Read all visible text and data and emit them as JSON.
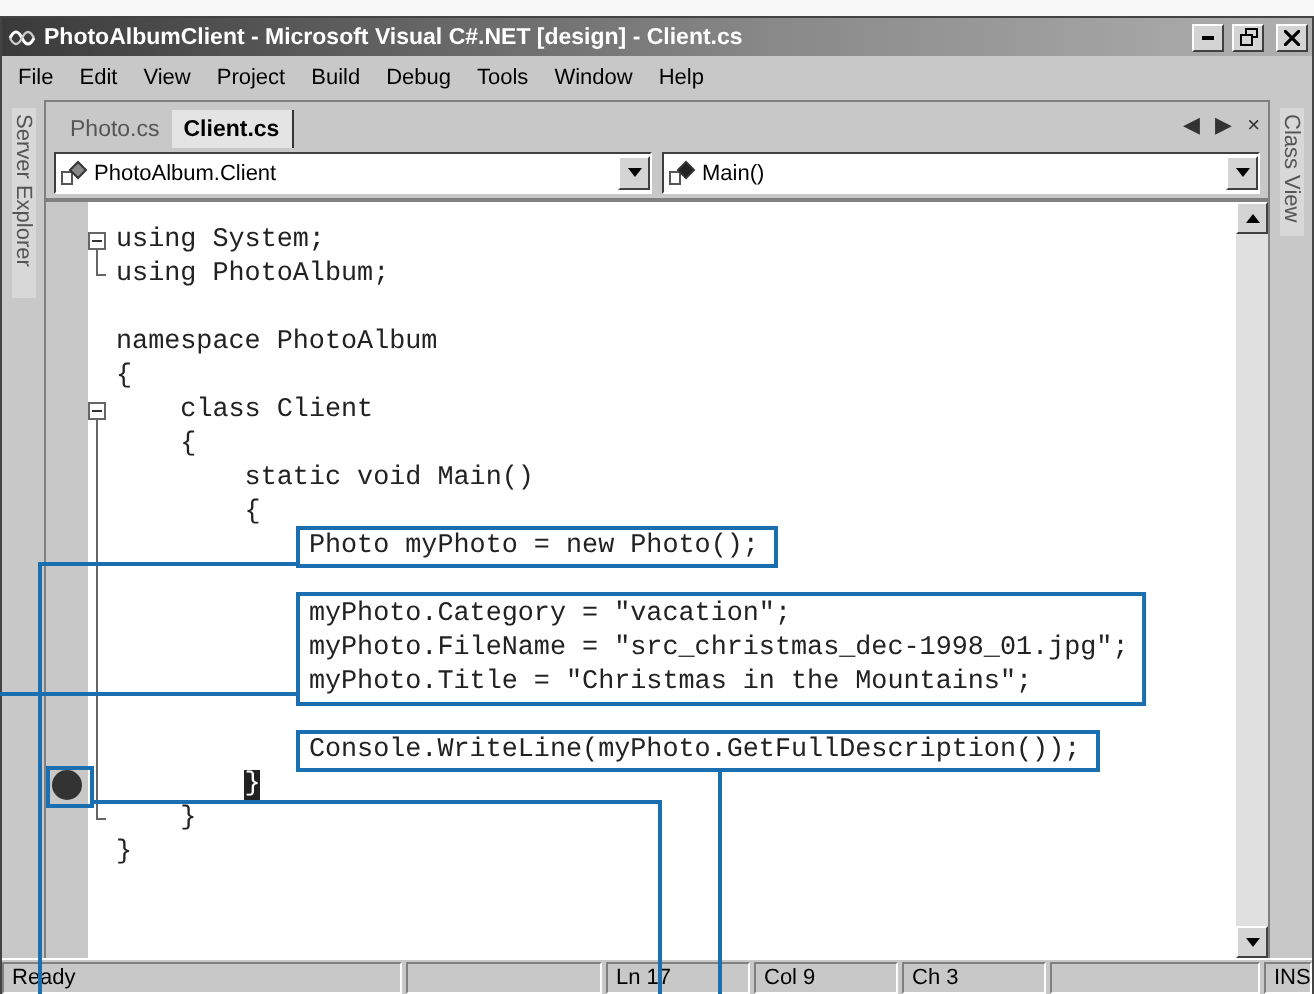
{
  "window": {
    "title": "PhotoAlbumClient - Microsoft Visual C#.NET [design] - Client.cs"
  },
  "menu": [
    "File",
    "Edit",
    "View",
    "Project",
    "Build",
    "Debug",
    "Tools",
    "Window",
    "Help"
  ],
  "side_tabs": {
    "left": "Server Explorer",
    "right": "Class View"
  },
  "tabs": [
    {
      "label": "Photo.cs",
      "selected": false
    },
    {
      "label": "Client.cs",
      "selected": true
    }
  ],
  "tab_controls": [
    "◀",
    "▶",
    "×"
  ],
  "dropdowns": [
    {
      "value": "PhotoAlbum.Client"
    },
    {
      "value": "Main()"
    }
  ],
  "code": [
    {
      "text": "using System;",
      "kind": "start",
      "breakpoint": false,
      "caret": false
    },
    {
      "text": "using PhotoAlbum;",
      "kind": "end",
      "breakpoint": false,
      "caret": false
    },
    {
      "kind": "plain",
      "breakpoint": false,
      "caret": false
    },
    {
      "text": "namespace PhotoAlbum",
      "kind": "plain",
      "breakpoint": false,
      "caret": false
    },
    {
      "text": "{",
      "kind": "plain",
      "breakpoint": false,
      "caret": false
    },
    {
      "text": "    class Client",
      "kind": "start",
      "breakpoint": false,
      "caret": false
    },
    {
      "text": "    {",
      "kind": "inside",
      "breakpoint": false,
      "caret": false
    },
    {
      "text": "        static void Main()",
      "kind": "inside",
      "breakpoint": false,
      "caret": false
    },
    {
      "text": "        {",
      "kind": "inside",
      "breakpoint": false,
      "caret": false
    },
    {
      "text": "            Photo myPhoto = new Photo();",
      "kind": "inside",
      "breakpoint": false,
      "caret": false,
      "callout": true
    },
    {
      "kind": "inside",
      "breakpoint": false,
      "caret": false
    },
    {
      "text": "            myPhoto.Category = \"vacation\";",
      "kind": "inside",
      "breakpoint": false,
      "caret": false,
      "callout": true
    },
    {
      "text": "            myPhoto.FileName = \"src_christmas_dec-1998_01.jpg\";",
      "kind": "inside",
      "breakpoint": false,
      "caret": false,
      "callout": true
    },
    {
      "text": "            myPhoto.Title = \"Christmas in the Mountains\";",
      "kind": "inside",
      "breakpoint": false,
      "caret": false,
      "callout": true
    },
    {
      "kind": "inside",
      "breakpoint": false,
      "caret": false
    },
    {
      "text": "            Console.WriteLine(myPhoto.GetFullDescription());",
      "kind": "inside",
      "breakpoint": false,
      "caret": false,
      "callout": true
    },
    {
      "text": "        }",
      "kind": "inside",
      "breakpoint": true,
      "caret": true
    },
    {
      "text": "    }",
      "kind": "end",
      "breakpoint": false,
      "caret": false
    },
    {
      "text": "}",
      "kind": "plain",
      "breakpoint": false,
      "caret": false
    }
  ],
  "status_bar": [
    {
      "kind": "text",
      "text": "Ready"
    },
    {
      "kind": "spacer"
    },
    {
      "kind": "text",
      "text": "Ln 17"
    },
    {
      "kind": "text",
      "text": "Col 9"
    },
    {
      "kind": "text",
      "text": "Ch 3"
    },
    {
      "kind": "spacer"
    },
    {
      "kind": "text",
      "text": "INS"
    }
  ]
}
